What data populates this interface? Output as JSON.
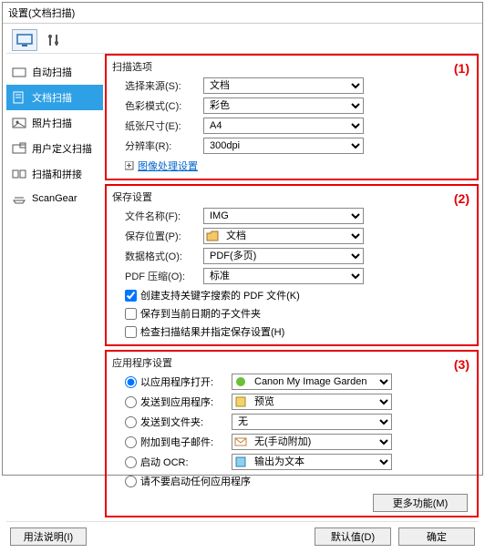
{
  "window": {
    "title": "设置(文档扫描)"
  },
  "sidebar": {
    "items": [
      {
        "label": "自动扫描"
      },
      {
        "label": "文档扫描"
      },
      {
        "label": "照片扫描"
      },
      {
        "label": "用户定义扫描"
      },
      {
        "label": "扫描和拼接"
      },
      {
        "label": "ScanGear"
      }
    ]
  },
  "section_numbers": {
    "s1": "(1)",
    "s2": "(2)",
    "s3": "(3)"
  },
  "scan_options": {
    "title": "扫描选项",
    "source_label": "选择来源(S):",
    "source_value": "文档",
    "color_label": "色彩模式(C):",
    "color_value": "彩色",
    "paper_label": "纸张尺寸(E):",
    "paper_value": "A4",
    "res_label": "分辨率(R):",
    "res_value": "300dpi",
    "adv_link": "图像处理设置"
  },
  "save_settings": {
    "title": "保存设置",
    "filename_label": "文件名称(F):",
    "filename_value": "IMG",
    "saveto_label": "保存位置(P):",
    "saveto_value": "文档",
    "format_label": "数据格式(O):",
    "format_value": "PDF(多页)",
    "compress_label": "PDF 压缩(O):",
    "compress_value": "标准",
    "chk1": "创建支持关键字搜索的 PDF 文件(K)",
    "chk2": "保存到当前日期的子文件夹",
    "chk3": "检查扫描结果并指定保存设置(H)"
  },
  "app_settings": {
    "title": "应用程序设置",
    "r1": "以应用程序打开:",
    "r1_value": "Canon My Image Garden",
    "r2": "发送到应用程序:",
    "r2_value": "预览",
    "r3": "发送到文件夹:",
    "r3_value": "无",
    "r4": "附加到电子邮件:",
    "r4_value": "无(手动附加)",
    "r5": "启动 OCR:",
    "r5_value": "输出为文本",
    "r6": "请不要启动任何应用程序",
    "more_btn": "更多功能(M)"
  },
  "footer": {
    "help": "用法说明(I)",
    "defaults": "默认值(D)",
    "ok": "确定"
  }
}
